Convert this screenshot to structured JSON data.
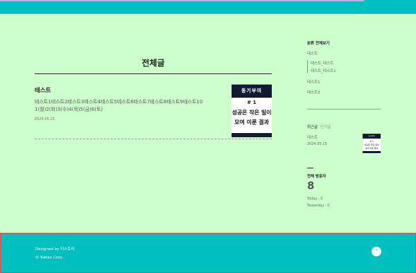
{
  "main": {
    "page_title": "전체글",
    "post": {
      "title": "테스트",
      "excerpt": "테스트1테스트2테스트3테스트4테스트5테스트6테스트7테스트8테스트9테스트10 1(월)2(화)3(수)4(목)5(금)6(토)",
      "date": "2024.05.15",
      "thumbnail": {
        "header": "동기부여",
        "number": "# 1",
        "line1": "성공은 작은 일이",
        "line2": "모여 이룬 결과"
      }
    }
  },
  "sidebar": {
    "category_heading": "분류 전체보기",
    "categories": [
      {
        "label": "테스트"
      },
      {
        "label": "테스트_테스트"
      },
      {
        "label": "테스트_테스트1"
      },
      {
        "label": "테스트1"
      },
      {
        "label": "테스트3"
      }
    ],
    "tabs": {
      "recent": "최근글",
      "popular": "인기글"
    },
    "recent_post": {
      "title": "테스트",
      "date": "2024.05.15",
      "thumb": {
        "header": "동기부여",
        "number": "# 1",
        "line1": "성공은 작은 일이",
        "line2": "모여 이룬 결과"
      }
    },
    "visitors": {
      "heading": "전체 방문자",
      "count": "8",
      "today": "Today : 0",
      "yesterday": "Yesterday : 0"
    }
  },
  "footer": {
    "designed_by": "Designed by 티스토리",
    "copyright": "© Kakao Corp.",
    "top_icon": "chevron-up-icon"
  },
  "colors": {
    "background": "#ccffcc",
    "accent": "#00bfbf",
    "thumbnail_dark": "#111a33"
  }
}
